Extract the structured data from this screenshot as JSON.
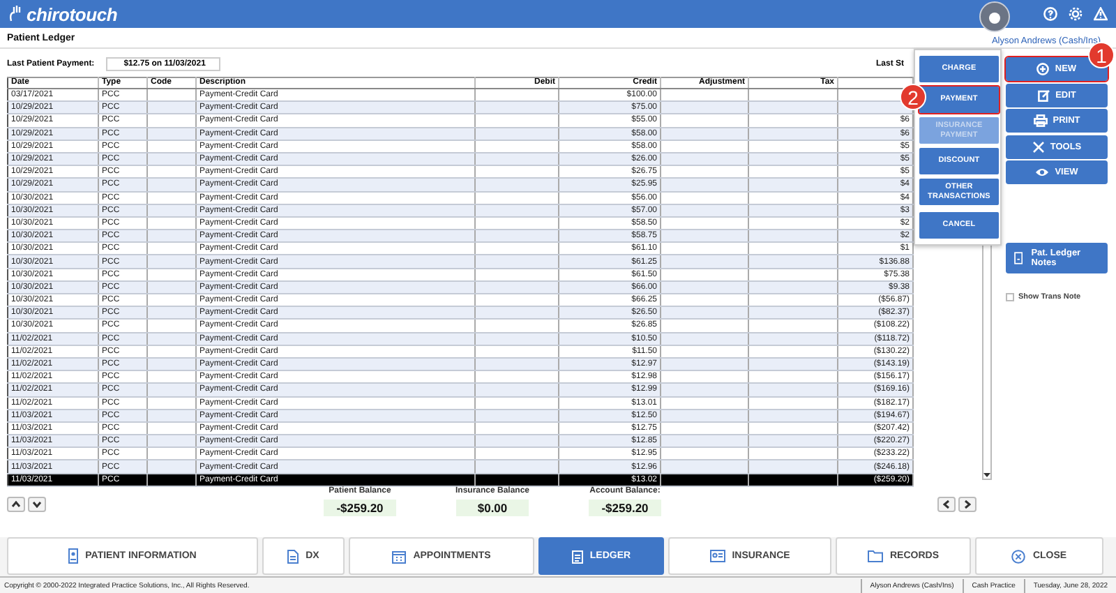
{
  "header": {
    "logo": "chirotouch"
  },
  "page_title": "Patient Ledger",
  "user": "Alyson Andrews (Cash/Ins)",
  "last_payment": {
    "label": "Last Patient Payment:",
    "value": "$12.75 on 11/03/2021"
  },
  "last_statement_label": "Last St",
  "table": {
    "columns": [
      "Date",
      "Type",
      "Code",
      "Description",
      "Debit",
      "Credit",
      "Adjustment",
      "Tax"
    ],
    "rows": [
      {
        "date": "03/17/2021",
        "type": "PCC",
        "description": "Payment-Credit Card",
        "credit": "$100.00",
        "selected": false
      },
      {
        "date": "10/29/2021",
        "type": "PCC",
        "description": "Payment-Credit Card",
        "credit": "$75.00",
        "selected": false
      },
      {
        "date": "10/29/2021",
        "type": "PCC",
        "description": "Payment-Credit Card",
        "credit": "$55.00",
        "balance": "$6",
        "selected": false
      },
      {
        "date": "10/29/2021",
        "type": "PCC",
        "description": "Payment-Credit Card",
        "credit": "$58.00",
        "balance": "$6",
        "selected": false
      },
      {
        "date": "10/29/2021",
        "type": "PCC",
        "description": "Payment-Credit Card",
        "credit": "$58.00",
        "balance": "$5",
        "selected": false
      },
      {
        "date": "10/29/2021",
        "type": "PCC",
        "description": "Payment-Credit Card",
        "credit": "$26.00",
        "balance": "$5",
        "selected": false
      },
      {
        "date": "10/29/2021",
        "type": "PCC",
        "description": "Payment-Credit Card",
        "credit": "$26.75",
        "balance": "$5",
        "selected": false
      },
      {
        "date": "10/29/2021",
        "type": "PCC",
        "description": "Payment-Credit Card",
        "credit": "$25.95",
        "balance": "$4",
        "selected": false
      },
      {
        "date": "10/30/2021",
        "type": "PCC",
        "description": "Payment-Credit Card",
        "credit": "$56.00",
        "balance": "$4",
        "selected": false
      },
      {
        "date": "10/30/2021",
        "type": "PCC",
        "description": "Payment-Credit Card",
        "credit": "$57.00",
        "balance": "$3",
        "selected": false
      },
      {
        "date": "10/30/2021",
        "type": "PCC",
        "description": "Payment-Credit Card",
        "credit": "$58.50",
        "balance": "$2",
        "selected": false
      },
      {
        "date": "10/30/2021",
        "type": "PCC",
        "description": "Payment-Credit Card",
        "credit": "$58.75",
        "balance": "$2",
        "selected": false
      },
      {
        "date": "10/30/2021",
        "type": "PCC",
        "description": "Payment-Credit Card",
        "credit": "$61.10",
        "balance": "$1",
        "selected": false
      },
      {
        "date": "10/30/2021",
        "type": "PCC",
        "description": "Payment-Credit Card",
        "credit": "$61.25",
        "balance": "$136.88",
        "selected": false
      },
      {
        "date": "10/30/2021",
        "type": "PCC",
        "description": "Payment-Credit Card",
        "credit": "$61.50",
        "balance": "$75.38",
        "selected": false
      },
      {
        "date": "10/30/2021",
        "type": "PCC",
        "description": "Payment-Credit Card",
        "credit": "$66.00",
        "balance": "$9.38",
        "selected": false
      },
      {
        "date": "10/30/2021",
        "type": "PCC",
        "description": "Payment-Credit Card",
        "credit": "$66.25",
        "balance": "($56.87)",
        "selected": false
      },
      {
        "date": "10/30/2021",
        "type": "PCC",
        "description": "Payment-Credit Card",
        "credit": "$26.50",
        "balance": "($82.37)",
        "selected": false
      },
      {
        "date": "10/30/2021",
        "type": "PCC",
        "description": "Payment-Credit Card",
        "credit": "$26.85",
        "balance": "($108.22)",
        "selected": false
      },
      {
        "date": "11/02/2021",
        "type": "PCC",
        "description": "Payment-Credit Card",
        "credit": "$10.50",
        "balance": "($118.72)",
        "selected": false
      },
      {
        "date": "11/02/2021",
        "type": "PCC",
        "description": "Payment-Credit Card",
        "credit": "$11.50",
        "balance": "($130.22)",
        "selected": false
      },
      {
        "date": "11/02/2021",
        "type": "PCC",
        "description": "Payment-Credit Card",
        "credit": "$12.97",
        "balance": "($143.19)",
        "selected": false
      },
      {
        "date": "11/02/2021",
        "type": "PCC",
        "description": "Payment-Credit Card",
        "credit": "$12.98",
        "balance": "($156.17)",
        "selected": false
      },
      {
        "date": "11/02/2021",
        "type": "PCC",
        "description": "Payment-Credit Card",
        "credit": "$12.99",
        "balance": "($169.16)",
        "selected": false
      },
      {
        "date": "11/02/2021",
        "type": "PCC",
        "description": "Payment-Credit Card",
        "credit": "$13.01",
        "balance": "($182.17)",
        "selected": false
      },
      {
        "date": "11/03/2021",
        "type": "PCC",
        "description": "Payment-Credit Card",
        "credit": "$12.50",
        "balance": "($194.67)",
        "selected": false
      },
      {
        "date": "11/03/2021",
        "type": "PCC",
        "description": "Payment-Credit Card",
        "credit": "$12.75",
        "balance": "($207.42)",
        "selected": false
      },
      {
        "date": "11/03/2021",
        "type": "PCC",
        "description": "Payment-Credit Card",
        "credit": "$12.85",
        "balance": "($220.27)",
        "selected": false
      },
      {
        "date": "11/03/2021",
        "type": "PCC",
        "description": "Payment-Credit Card",
        "credit": "$12.95",
        "balance": "($233.22)",
        "selected": false
      },
      {
        "date": "11/03/2021",
        "type": "PCC",
        "description": "Payment-Credit Card",
        "credit": "$12.96",
        "balance": "($246.18)",
        "selected": false
      },
      {
        "date": "11/03/2021",
        "type": "PCC",
        "description": "Payment-Credit Card",
        "credit": "$13.02",
        "balance": "($259.20)",
        "selected": true
      }
    ]
  },
  "popup_menu": [
    {
      "label": "CHARGE",
      "disabled": false,
      "outlined": false
    },
    {
      "label": "PAYMENT",
      "disabled": false,
      "outlined": true
    },
    {
      "label": "INSURANCE PAYMENT",
      "disabled": true,
      "outlined": false
    },
    {
      "label": "DISCOUNT",
      "disabled": false,
      "outlined": false
    },
    {
      "label": "OTHER TRANSACTIONS",
      "disabled": false,
      "outlined": false
    },
    {
      "label": "CANCEL",
      "disabled": false,
      "outlined": false
    }
  ],
  "side_buttons": [
    {
      "label": "NEW",
      "outlined": true
    },
    {
      "label": "EDIT",
      "outlined": false
    },
    {
      "label": "PRINT",
      "outlined": false
    },
    {
      "label": "TOOLS",
      "outlined": false
    },
    {
      "label": "VIEW",
      "outlined": false
    }
  ],
  "notes_button": "Pat. Ledger Notes",
  "show_trans_note": {
    "label": "Show Trans Note",
    "checked": false
  },
  "callouts": [
    {
      "label": "1"
    },
    {
      "label": "2"
    }
  ],
  "balances": [
    {
      "label": "Patient Balance",
      "value": "-$259.20"
    },
    {
      "label": "Insurance Balance",
      "value": "$0.00"
    },
    {
      "label": "Account Balance:",
      "value": "-$259.20"
    }
  ],
  "tabs": [
    {
      "label": "PATIENT INFORMATION",
      "selected": false
    },
    {
      "label": "DX",
      "selected": false
    },
    {
      "label": "APPOINTMENTS",
      "selected": false
    },
    {
      "label": "LEDGER",
      "selected": true
    },
    {
      "label": "INSURANCE",
      "selected": false
    },
    {
      "label": "RECORDS",
      "selected": false
    },
    {
      "label": "CLOSE",
      "selected": false
    }
  ],
  "status_bar": {
    "copyright": "Copyright © 2000-2022 Integrated Practice Solutions, Inc., All Rights Reserved.",
    "segments": [
      "Alyson Andrews (Cash/Ins)",
      "Cash Practice",
      "Tuesday, June 28, 2022"
    ]
  }
}
